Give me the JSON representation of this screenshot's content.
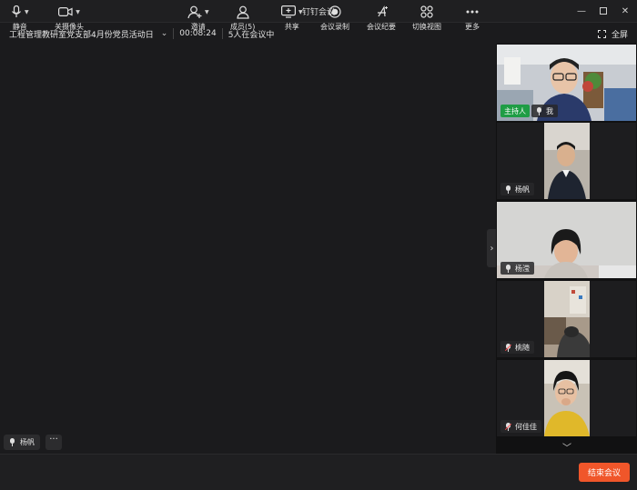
{
  "window": {
    "title": "钉钉会议"
  },
  "infobar": {
    "meeting_title": "工程管理教研室党支部4月份党员活动日",
    "timer": "00:08:24",
    "participant_count_text": "5人在会议中",
    "fullscreen_label": "全屏"
  },
  "stage": {
    "active_speaker": "杨帆"
  },
  "participants": [
    {
      "name": "我",
      "host_badge": "主持人",
      "mic": "on"
    },
    {
      "name": "杨帆",
      "mic": "on"
    },
    {
      "name": "杨滢",
      "mic": "on"
    },
    {
      "name": "桃随",
      "mic": "muted"
    },
    {
      "name": "何佳佳",
      "mic": "muted"
    }
  ],
  "toolbar": {
    "mute": "静音",
    "camera": "关摄像头",
    "invite": "邀请",
    "members": "成员(5)",
    "share": "共享",
    "record": "会议录制",
    "minutes": "会议纪要",
    "switch_view": "切换视图",
    "more": "更多",
    "end": "结束会议"
  },
  "colors": {
    "end_button": "#f0562a",
    "host_badge": "#1f9d45",
    "background": "#1b1b1d"
  }
}
